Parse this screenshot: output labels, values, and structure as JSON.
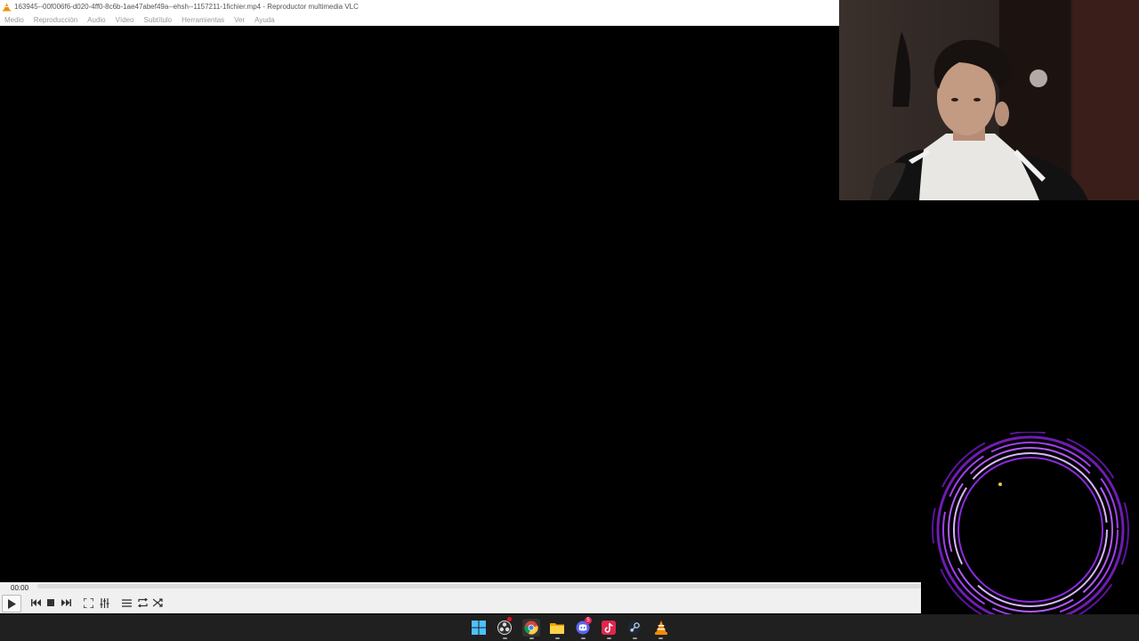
{
  "window": {
    "title": "163945--00f006f6-d020-4ff0-8c6b-1ae47abef49a--ehsh--1157211-1fichier.mp4 - Reproductor multimedia VLC",
    "app_icon": "vlc-cone-icon"
  },
  "menu": {
    "items": [
      "Medio",
      "Reproducción",
      "Audio",
      "Vídeo",
      "Subtítulo",
      "Herramientas",
      "Ver",
      "Ayuda"
    ]
  },
  "player": {
    "time_elapsed": "00:00",
    "progress": 0,
    "buttons": [
      "play-icon",
      "previous-icon",
      "stop-icon",
      "next-icon",
      "fullscreen-icon",
      "extended-settings-icon",
      "playlist-icon",
      "loop-icon",
      "shuffle-icon"
    ]
  },
  "taskbar": {
    "apps": [
      "windows-start-icon",
      "obs-icon",
      "chrome-icon",
      "file-explorer-icon",
      "discord-icon",
      "tiktok-icon",
      "steam-icon",
      "vlc-icon"
    ],
    "discord_badge": "5"
  },
  "colors": {
    "visualizer": "#9b30e8",
    "vlc_orange": "#f28c00",
    "taskbar": "#202020"
  }
}
